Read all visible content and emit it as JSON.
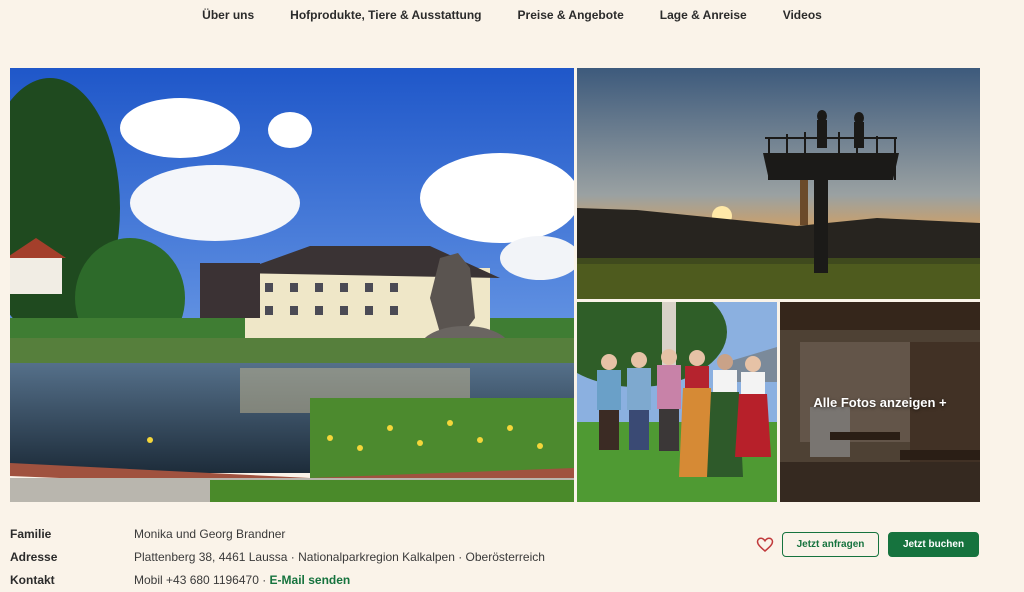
{
  "nav": {
    "items": [
      "Über uns",
      "Hofprodukte, Tiere & Ausstattung",
      "Preise & Angebote",
      "Lage & Anreise",
      "Videos"
    ]
  },
  "gallery": {
    "all_photos_label": "Alle Fotos anzeigen +"
  },
  "info": {
    "family_label": "Familie",
    "family_value": "Monika und Georg Brandner",
    "address_label": "Adresse",
    "address_value": "Plattenberg 38, 4461 Laussa · Nationalparkregion Kalkalpen · Oberösterreich",
    "contact_label": "Kontakt",
    "contact_value": "Mobil +43 680 1196470 · ",
    "email_link": "E-Mail senden"
  },
  "actions": {
    "favorite_icon": "heart-icon",
    "inquire_label": "Jetzt anfragen",
    "book_label": "Jetzt buchen"
  },
  "colors": {
    "background": "#faf3e9",
    "accent_green": "#16733e",
    "heart_red": "#c0393b"
  }
}
